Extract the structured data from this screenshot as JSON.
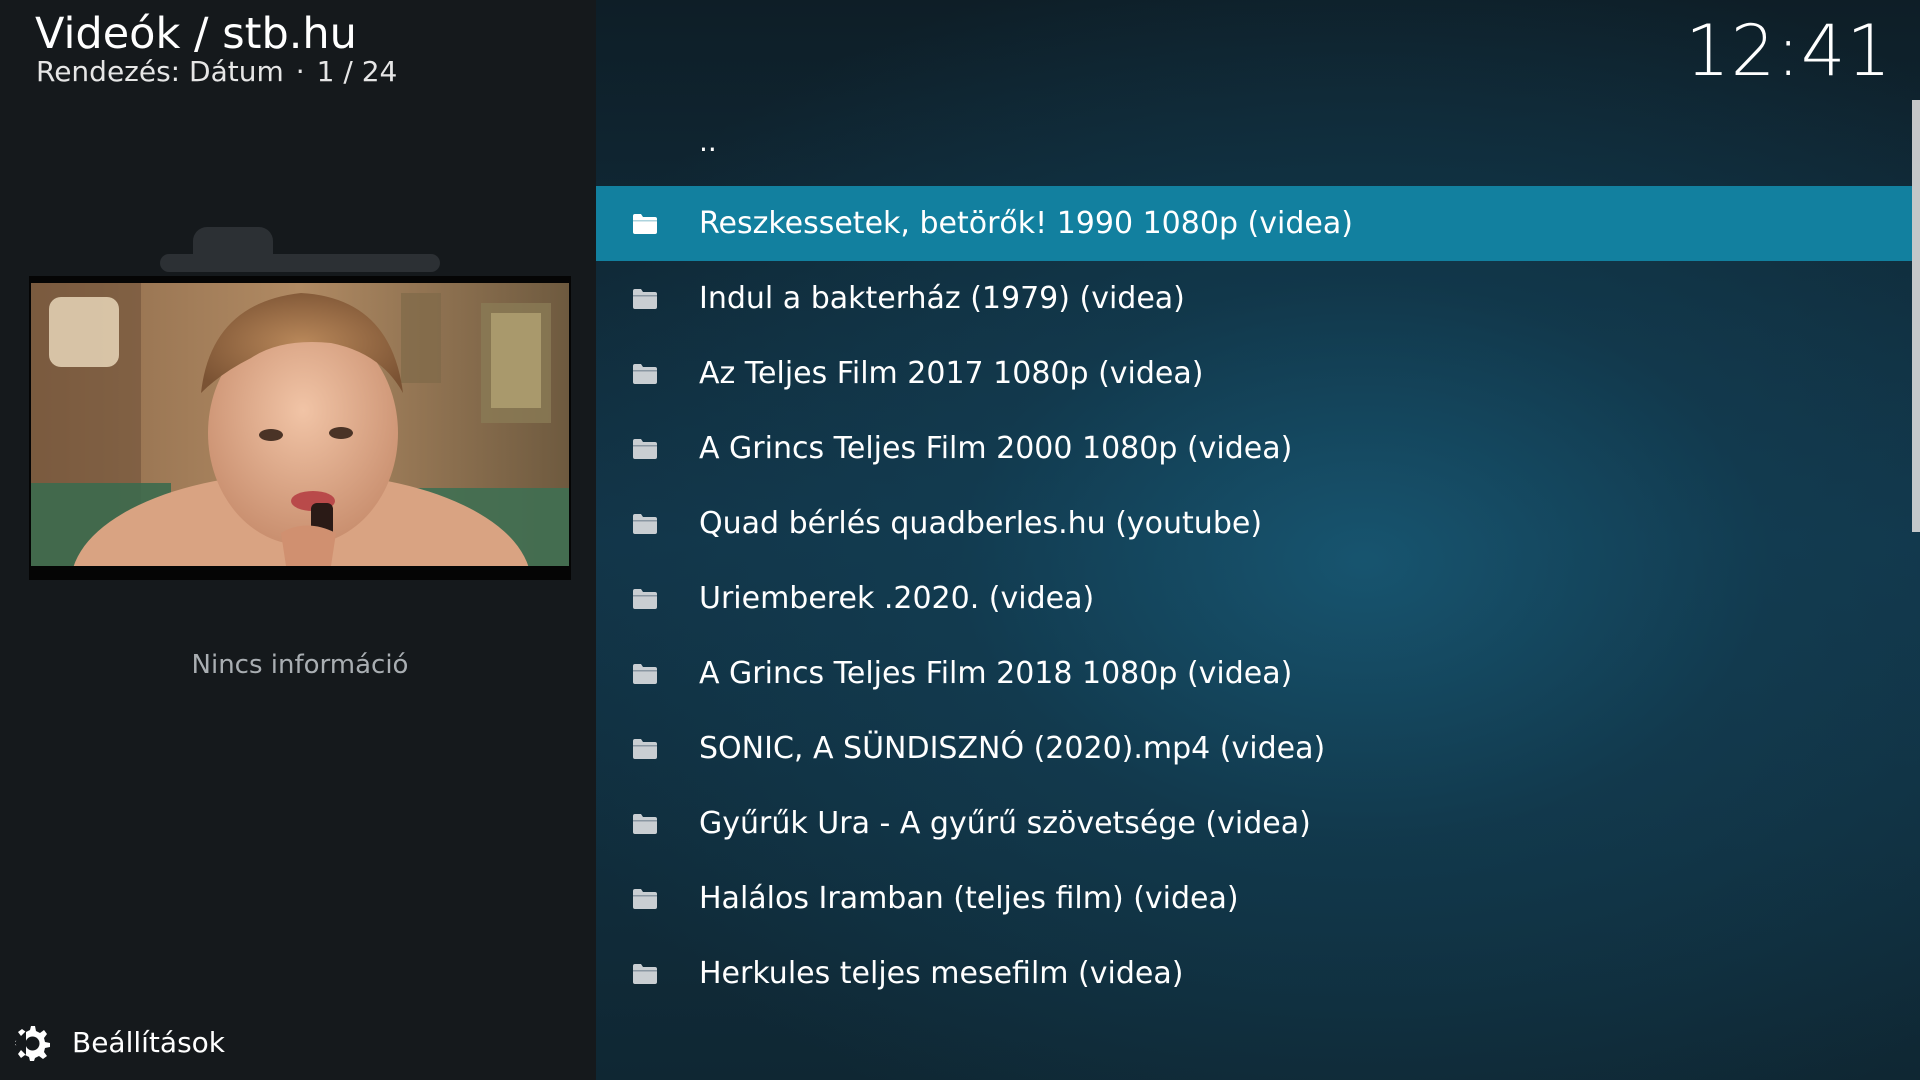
{
  "header": {
    "title": "Videók / stb.hu",
    "sort_label": "Rendezés: Dátum",
    "separator": "·",
    "position": "1 / 24"
  },
  "clock": "12:41",
  "info": {
    "no_info_text": "Nincs információ"
  },
  "settings": {
    "label": "Beállítások",
    "icon": "settings-gear-icon"
  },
  "colors": {
    "selected_row": "#12809f",
    "left_panel": "#15191c"
  },
  "list": {
    "parent_label": "..",
    "items": [
      {
        "label": "Reszkessetek, betörők! 1990 1080p (videa)",
        "icon": "folder-icon",
        "selected": true
      },
      {
        "label": "Indul a bakterház (1979) (videa)",
        "icon": "folder-icon"
      },
      {
        "label": "Az Teljes Film 2017 1080p (videa)",
        "icon": "folder-icon"
      },
      {
        "label": "A Grincs Teljes Film 2000 1080p (videa)",
        "icon": "folder-icon"
      },
      {
        "label": "Quad bérlés quadberles.hu (youtube)",
        "icon": "folder-icon"
      },
      {
        "label": "Uriemberek .2020. (videa)",
        "icon": "folder-icon"
      },
      {
        "label": "A Grincs Teljes Film 2018 1080p (videa)",
        "icon": "folder-icon"
      },
      {
        "label": "SONIC, A SÜNDISZNÓ (2020).mp4 (videa)",
        "icon": "folder-icon"
      },
      {
        "label": "Gyűrűk Ura - A gyűrű szövetsége (videa)",
        "icon": "folder-icon"
      },
      {
        "label": "Halálos Iramban (teljes film) (videa)",
        "icon": "folder-icon"
      },
      {
        "label": "Herkules teljes mesefilm (videa)",
        "icon": "folder-icon"
      }
    ]
  }
}
